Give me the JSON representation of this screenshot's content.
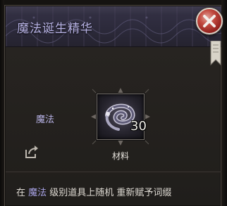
{
  "item": {
    "title": "魔法诞生精华",
    "category": "魔法",
    "count": "30",
    "type_label": "材料"
  },
  "description": {
    "prefix": "在 ",
    "highlight": "魔法",
    "rest": " 级别道具上随机 重新赋予词缀"
  },
  "icons": {
    "close": "close-icon",
    "share": "share-icon",
    "bookmark": "bookmark-icon",
    "item": "serpent-essence-icon"
  },
  "colors": {
    "title": "#b8b3e6",
    "highlight": "#a7a2e4",
    "close_red": "#c24a40"
  }
}
